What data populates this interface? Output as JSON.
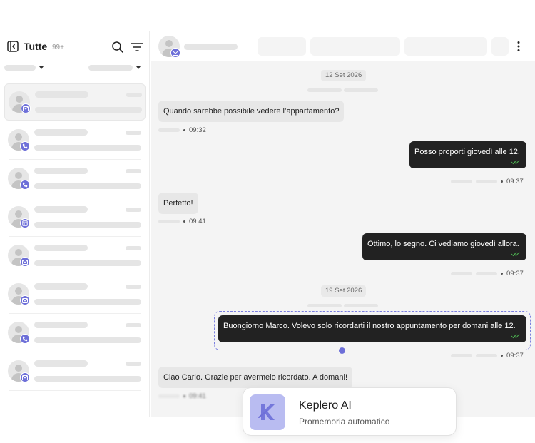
{
  "sidebar": {
    "title": "Tutte",
    "count": "99+",
    "icons": {
      "collapse": "sidebar-collapse-icon",
      "search": "search-icon",
      "filter": "filter-icon"
    },
    "conversations": [
      {
        "channel": "email",
        "active": true
      },
      {
        "channel": "phone",
        "active": false
      },
      {
        "channel": "phone",
        "active": false
      },
      {
        "channel": "form",
        "active": false
      },
      {
        "channel": "email",
        "active": false
      },
      {
        "channel": "email",
        "active": false
      },
      {
        "channel": "phone",
        "active": false
      },
      {
        "channel": "email",
        "active": false
      }
    ]
  },
  "chat": {
    "header_channel": "email",
    "dates": [
      "12 Set 2026",
      "19 Set 2026"
    ],
    "messages": [
      {
        "direction": "in",
        "text": "Quando sarebbe possibile vedere l’appartamento?",
        "time": "09:32"
      },
      {
        "direction": "out",
        "text": "Posso proporti giovedì alle 12.",
        "time": "09:37"
      },
      {
        "direction": "in",
        "text": "Perfetto!",
        "time": "09:41"
      },
      {
        "direction": "out",
        "text": "Ottimo, lo segno. Ci vediamo giovedì allora.",
        "time": "09:37"
      },
      {
        "direction": "out",
        "text": "Buongiorno Marco. Volevo solo ricordarti il nostro appuntamento per domani alle 12.",
        "time": "09:37",
        "highlighted": true
      },
      {
        "direction": "in",
        "text": "Ciao Carlo. Grazie per avermelo ricordato. A domani!",
        "time": "09:41"
      }
    ]
  },
  "ai_card": {
    "name": "Keplero AI",
    "subtitle": "Promemoria automatico",
    "icon": "keplero-logo-icon"
  },
  "colors": {
    "accent": "#6d6fd8",
    "accent_light": "#b9bcf1",
    "outgoing_bubble": "#222222",
    "incoming_bubble": "#e7e7e7",
    "read_ticks": "#4caf50"
  }
}
